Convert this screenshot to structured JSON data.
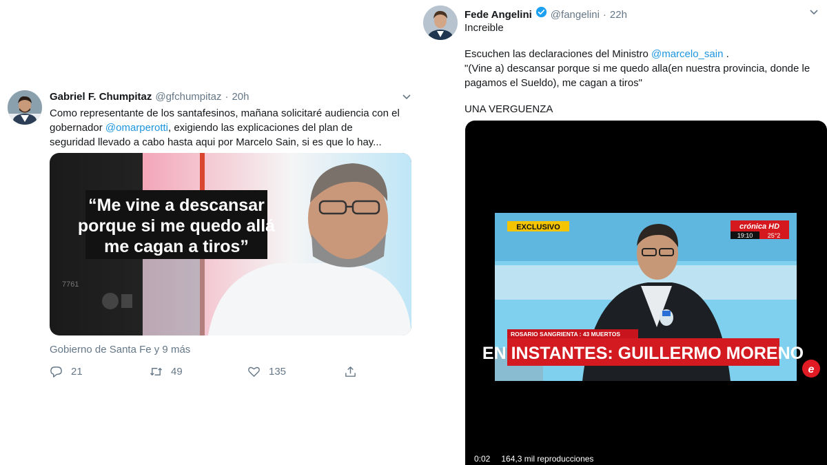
{
  "tweet_left": {
    "name": "Gabriel F. Chumpitaz",
    "handle": "@gfchumpitaz",
    "dot": "·",
    "time": "20h",
    "text_line1": "Como representante de los santafesinos, mañana solicitaré audiencia con el",
    "text_line2_pre": "gobernador ",
    "text_line2_mention": "@omarperotti",
    "text_line2_post": ",  exigiendo las explicaciones del plan de",
    "text_line3": "seguridad llevado a cabo hasta aqui por Marcelo Sain, si es que lo hay...",
    "image_quote_1": "“Me vine a descansar",
    "image_quote_2": "porque si me quedo allá",
    "image_quote_3": "me cagan a tiros”",
    "image_side_number": "7761",
    "attribution": "Gobierno de Santa Fe y 9 más",
    "reply_count": "21",
    "retweet_count": "49",
    "like_count": "135"
  },
  "tweet_right": {
    "name": "Fede Angelini",
    "handle": "@fangelini",
    "dot": "·",
    "time": "22h",
    "line1": "Increible",
    "line2_pre": "Escuchen las declaraciones del Ministro ",
    "line2_mention": "@marcelo_sain",
    "line2_post": " .",
    "line3": "\"(Vine a) descansar porque si me quedo alla(en nuestra provincia, donde le",
    "line4": "pagamos el Sueldo), me cagan a tiros\"",
    "line5": "UNA VERGUENZA",
    "video": {
      "exclusive_label": "EXCLUSIVO",
      "channel_logo": "crónica HD",
      "clock": "19:10",
      "temperature": "25°2",
      "ticker_small": "ROSARIO SANGRIENTA : 43 MUERTOS",
      "ticker_big": "EN INSTANTES: GUILLERMO MORENO",
      "corner_logo": "e",
      "duration": "0:02",
      "views": "164,3 mil reproducciones"
    }
  },
  "colors": {
    "link": "#1b95e0",
    "muted": "#657786",
    "verified": "#1da1f2"
  },
  "icons": [
    "verified-badge-icon",
    "chevron-down-icon",
    "reply-icon",
    "retweet-icon",
    "like-icon",
    "share-icon"
  ]
}
